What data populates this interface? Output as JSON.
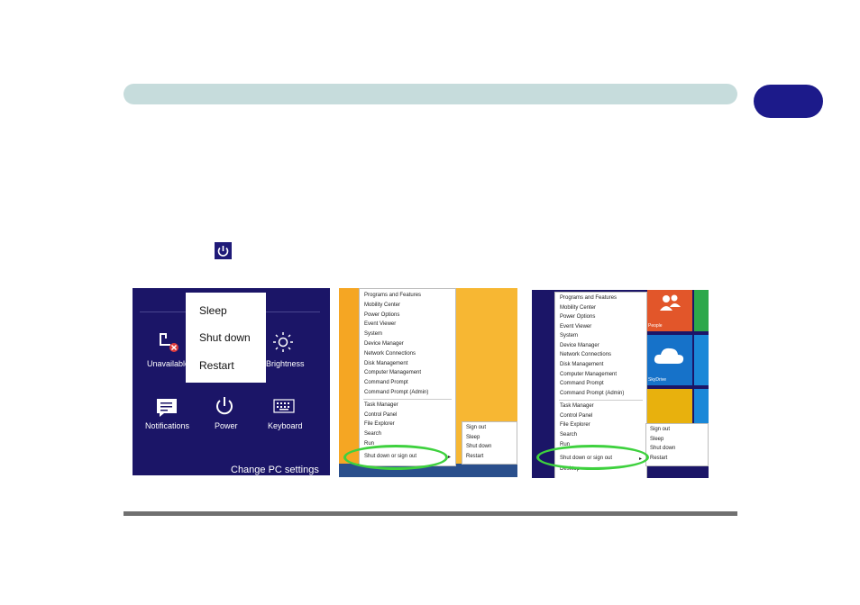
{
  "power_charm": {
    "menu": [
      "Sleep",
      "Shut down",
      "Restart"
    ],
    "icons": [
      {
        "name": "network-unavailable-icon",
        "label": "Unavailable"
      },
      {
        "name": "brightness-icon",
        "label": "Brightness"
      },
      {
        "name": "notifications-icon",
        "label": "Notifications"
      },
      {
        "name": "power-icon",
        "label": "Power"
      },
      {
        "name": "keyboard-icon",
        "label": "Keyboard"
      }
    ],
    "change_settings": "Change PC settings"
  },
  "context_menu": {
    "items": [
      "Programs and Features",
      "Mobility Center",
      "Power Options",
      "Event Viewer",
      "System",
      "Device Manager",
      "Network Connections",
      "Disk Management",
      "Computer Management",
      "Command Prompt",
      "Command Prompt (Admin)",
      "Task Manager",
      "Control Panel",
      "File Explorer",
      "Search",
      "Run",
      "Shut down or sign out",
      "Desktop"
    ],
    "submenu": [
      "Sign out",
      "Sleep",
      "Shut down",
      "Restart"
    ],
    "tiles": [
      "People",
      "SkyDrive"
    ]
  },
  "colors": {
    "accent_blue": "#1b1567",
    "highlight_green": "#3ed13e",
    "badge": "#1c1a8a",
    "header_bar": "#c6dcdc",
    "orange": "#f5a623"
  }
}
